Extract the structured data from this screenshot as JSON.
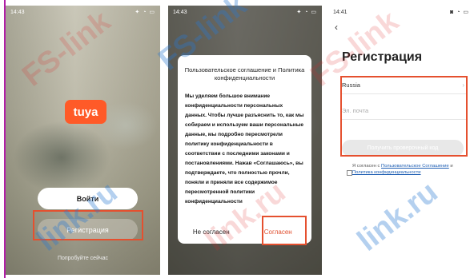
{
  "screens": {
    "welcome": {
      "time": "14:43",
      "logo": "tuya",
      "login_label": "Войти",
      "register_label": "Регистрация",
      "try_label": "Попробуйте сейчас"
    },
    "agreement": {
      "time": "14:43",
      "title": "Пользовательское соглашение и Политика конфиденциальности",
      "body": "Мы уделяем большое внимание конфиденциальности персональных данных. Чтобы лучше разъяснить то, как мы собираем и используем ваши персональные данные, мы подробно пересмотрели политику конфиденциальности в соответствии с последними законами и постановлениями. Нажав «Соглашаюсь», вы подтверждаете, что полностью прочли, поняли и приняли все содержимое пересмотренной политики конфиденциальности",
      "cancel_label": "Не согласен",
      "agree_label": "Согласен"
    },
    "registration": {
      "time": "14:41",
      "back_icon": "chevron-left-icon",
      "title": "Регистрация",
      "country": "Russia",
      "email_placeholder": "Эл. почта",
      "code_button": "Получить проверочный код",
      "agree_prefix": "Я согласен с",
      "agree_link1": "Пользовательское Соглашение",
      "agree_and": "и",
      "agree_link2": "Политика конфиденциальности"
    }
  },
  "colors": {
    "accent": "#e5502f",
    "link": "#1f5fb3"
  }
}
